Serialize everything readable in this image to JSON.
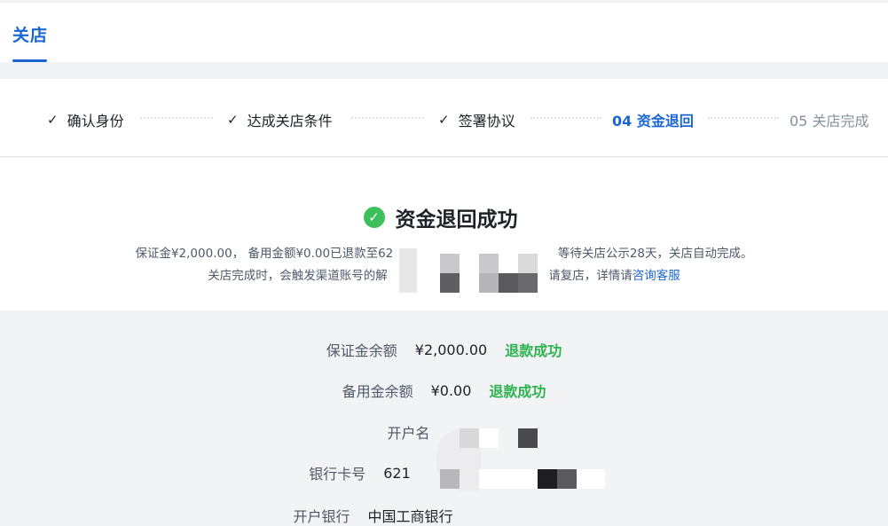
{
  "top_tab": {
    "label": "关店"
  },
  "steps": [
    {
      "label": "确认身份",
      "state": "done"
    },
    {
      "label": "达成关店条件",
      "state": "done"
    },
    {
      "label": "签署协议",
      "state": "done"
    },
    {
      "label": "04 资金退回",
      "state": "active"
    },
    {
      "label": "05 关店完成",
      "state": "pending"
    }
  ],
  "result": {
    "title": "资金退回成功",
    "line1_pre": "保证金¥2,000.00， 备用金额¥0.00已退款至62",
    "line1_post": "332， 等待关店公示28天，关店自动完成。",
    "line2_pre": "关店完成时，会触发渠道账号的解",
    "line2_post": "申请复店，详情请",
    "line2_link": "咨询客服"
  },
  "details": {
    "deposit": {
      "label": "保证金余额",
      "value": "¥2,000.00",
      "status": "退款成功"
    },
    "reserve": {
      "label": "备用金余额",
      "value": "¥0.00",
      "status": "退款成功"
    },
    "account_name": {
      "label": "开户名",
      "value": ""
    },
    "card_no": {
      "label": "银行卡号",
      "value": "621"
    },
    "bank": {
      "label": "开户银行",
      "value": "中国工商银行"
    }
  },
  "colors": {
    "primary": "#1966d2",
    "success": "#2fb351",
    "background": "#f2f3f5"
  },
  "icons": [
    "check-icon",
    "success-check-icon"
  ]
}
